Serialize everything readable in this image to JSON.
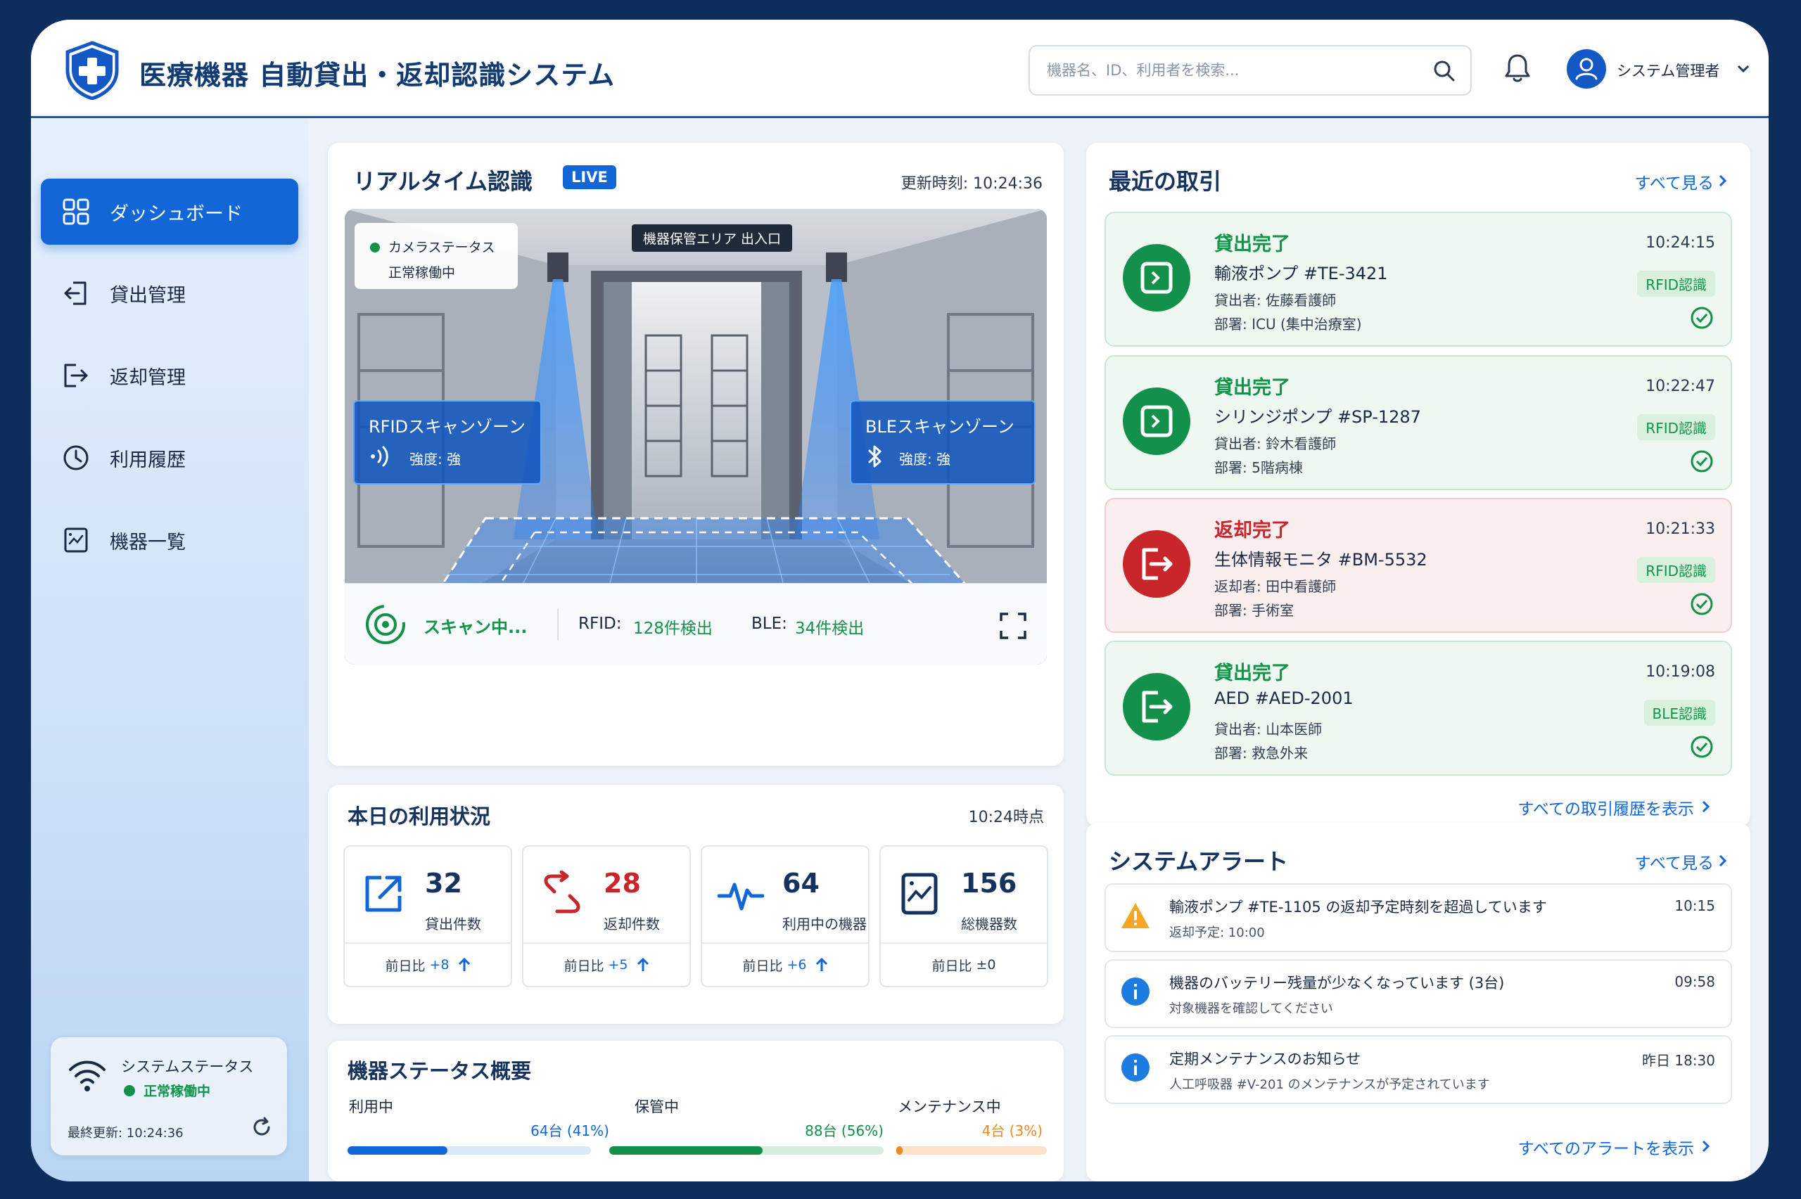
{
  "app": {
    "title": "医療機器 自動貸出・返却認識システム"
  },
  "header": {
    "search_placeholder": "機器名、ID、利用者を検索...",
    "user_name": "システム管理者"
  },
  "sidebar": {
    "items": [
      {
        "label": "ダッシュボード",
        "icon": "grid-icon",
        "active": true
      },
      {
        "label": "貸出管理",
        "icon": "checkout-icon",
        "active": false
      },
      {
        "label": "返却管理",
        "icon": "return-icon",
        "active": false
      },
      {
        "label": "利用履歴",
        "icon": "clock-icon",
        "active": false
      },
      {
        "label": "機器一覧",
        "icon": "device-list-icon",
        "active": false
      }
    ],
    "status": {
      "title": "システムステータス",
      "state": "正常稼働中",
      "last_update": "最終更新: 10:24:36"
    }
  },
  "realtime": {
    "title": "リアルタイム認識",
    "live_badge": "LIVE",
    "updated": "更新時刻: 10:24:36",
    "camera_status_label": "カメラステータス",
    "camera_status_value": "正常稼働中",
    "area_label": "機器保管エリア 出入口",
    "rfid_zone": {
      "title": "RFIDスキャンゾーン",
      "strength": "強度: 強"
    },
    "ble_zone": {
      "title": "BLEスキャンゾーン",
      "strength": "強度: 強"
    },
    "scanning": "スキャン中...",
    "rfid_label": "RFID:",
    "rfid_count": "128件検出",
    "ble_label": "BLE:",
    "ble_count": "34件検出"
  },
  "usage": {
    "title": "本日の利用状況",
    "as_of": "10:24時点",
    "stats": [
      {
        "value": "32",
        "label": "貸出件数",
        "foot": "前日比",
        "delta": "+8",
        "up": true,
        "color": "#1266d6"
      },
      {
        "value": "28",
        "label": "返却件数",
        "foot": "前日比",
        "delta": "+5",
        "up": true,
        "color": "#c8262a"
      },
      {
        "value": "64",
        "label": "利用中の機器",
        "foot": "前日比",
        "delta": "+6",
        "up": true,
        "color": "#1266d6"
      },
      {
        "value": "156",
        "label": "総機器数",
        "foot": "前日比",
        "delta": "±0",
        "up": false,
        "color": "#16325e"
      }
    ]
  },
  "device_status": {
    "title": "機器ステータス概要",
    "items": [
      {
        "label": "利用中",
        "value": "64台 (41%)",
        "fraction": 0.41,
        "color": "#1266d6",
        "track": "#dbe8f8"
      },
      {
        "label": "保管中",
        "value": "88台 (56%)",
        "fraction": 0.56,
        "color": "#13914a",
        "track": "#d5eedb"
      },
      {
        "label": "メンテナンス中",
        "value": "4台 (3%)",
        "fraction": 0.03,
        "color": "#f08a1c",
        "track": "#fbe2c8"
      }
    ]
  },
  "transactions": {
    "title": "最近の取引",
    "see_all": "すべて見る",
    "items": [
      {
        "status": "貸出完了",
        "device": "輸液ポンプ #TE-3421",
        "person": "貸出者: 佐藤看護師",
        "dept": "部署: ICU (集中治療室)",
        "time": "10:24:15",
        "method": "RFID認識",
        "kind": "green"
      },
      {
        "status": "貸出完了",
        "device": "シリンジポンプ #SP-1287",
        "person": "貸出者: 鈴木看護師",
        "dept": "部署: 5階病棟",
        "time": "10:22:47",
        "method": "RFID認識",
        "kind": "green"
      },
      {
        "status": "返却完了",
        "device": "生体情報モニタ #BM-5532",
        "person": "返却者: 田中看護師",
        "dept": "部署: 手術室",
        "time": "10:21:33",
        "method": "RFID認識",
        "kind": "red"
      },
      {
        "status": "貸出完了",
        "device": "AED #AED-2001",
        "person": "貸出者: 山本医師",
        "dept": "部署: 救急外来",
        "time": "10:19:08",
        "method": "BLE認識",
        "kind": "green"
      }
    ],
    "view_all_history": "すべての取引履歴を表示"
  },
  "alerts": {
    "title": "システムアラート",
    "see_all": "すべて見る",
    "items": [
      {
        "title": "輸液ポンプ #TE-1105 の返却予定時刻を超過しています",
        "sub": "返却予定: 10:00",
        "time": "10:15",
        "icon": "warning-icon"
      },
      {
        "title": "機器のバッテリー残量が少なくなっています (3台)",
        "sub": "対象機器を確認してください",
        "time": "09:58",
        "icon": "info-icon"
      },
      {
        "title": "定期メンテナンスのお知らせ",
        "sub": "人工呼吸器 #V-201 のメンテナンスが予定されています",
        "time": "昨日 18:30",
        "icon": "info-icon"
      }
    ],
    "view_all": "すべてのアラートを表示"
  }
}
